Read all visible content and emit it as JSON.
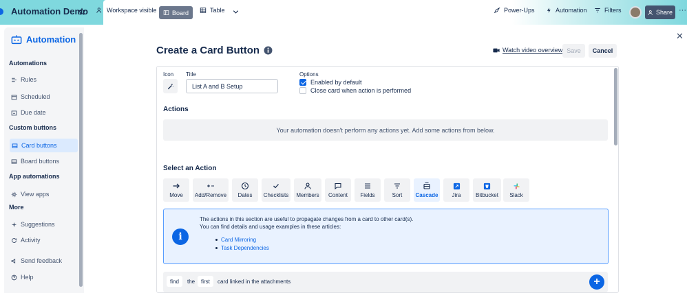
{
  "header": {
    "board_title": "Automation Demo",
    "workspace_visible": "Workspace visible",
    "tab_board": "Board",
    "tab_table": "Table",
    "power_ups": "Power-Ups",
    "automation": "Automation",
    "filters": "Filters",
    "share": "Share",
    "more": "···"
  },
  "sidebar": {
    "title": "Automation",
    "sections": {
      "automations": "Automations",
      "custom_buttons": "Custom buttons",
      "app_automations": "App automations",
      "more": "More"
    },
    "items": {
      "rules": "Rules",
      "scheduled": "Scheduled",
      "due_date": "Due date",
      "card_buttons": "Card buttons",
      "board_buttons": "Board buttons",
      "view_apps": "View apps",
      "suggestions": "Suggestions",
      "activity": "Activity",
      "send_feedback": "Send feedback",
      "help": "Help"
    }
  },
  "main": {
    "title": "Create a Card Button",
    "watch_video": "Watch video overview",
    "save": "Save",
    "cancel": "Cancel",
    "icon_label": "Icon",
    "title_label": "Title",
    "title_value": "List A and B Setup",
    "options_label": "Options",
    "opt_enabled": "Enabled by default",
    "opt_close": "Close card when action is performed",
    "actions_heading": "Actions",
    "empty_message": "Your automation doesn't perform any actions yet. Add some actions from below.",
    "select_heading": "Select an Action",
    "action_buttons": [
      "Move",
      "Add/Remove",
      "Dates",
      "Checklists",
      "Members",
      "Content",
      "Fields",
      "Sort",
      "Cascade",
      "Jira",
      "Bitbucket",
      "Slack"
    ],
    "info_line1": "The actions in this section are useful to propagate changes from a card to other card(s).",
    "info_line2": "You can find details and usage examples in these articles:",
    "info_links": [
      "Card Mirroring",
      "Task Dependencies"
    ],
    "bottom_row": {
      "find": "find",
      "the": "the",
      "first": "first",
      "rest": "card linked in the attachments"
    }
  },
  "colors": {
    "accent": "#0c66e4",
    "header_teal": "#7fd8de"
  }
}
